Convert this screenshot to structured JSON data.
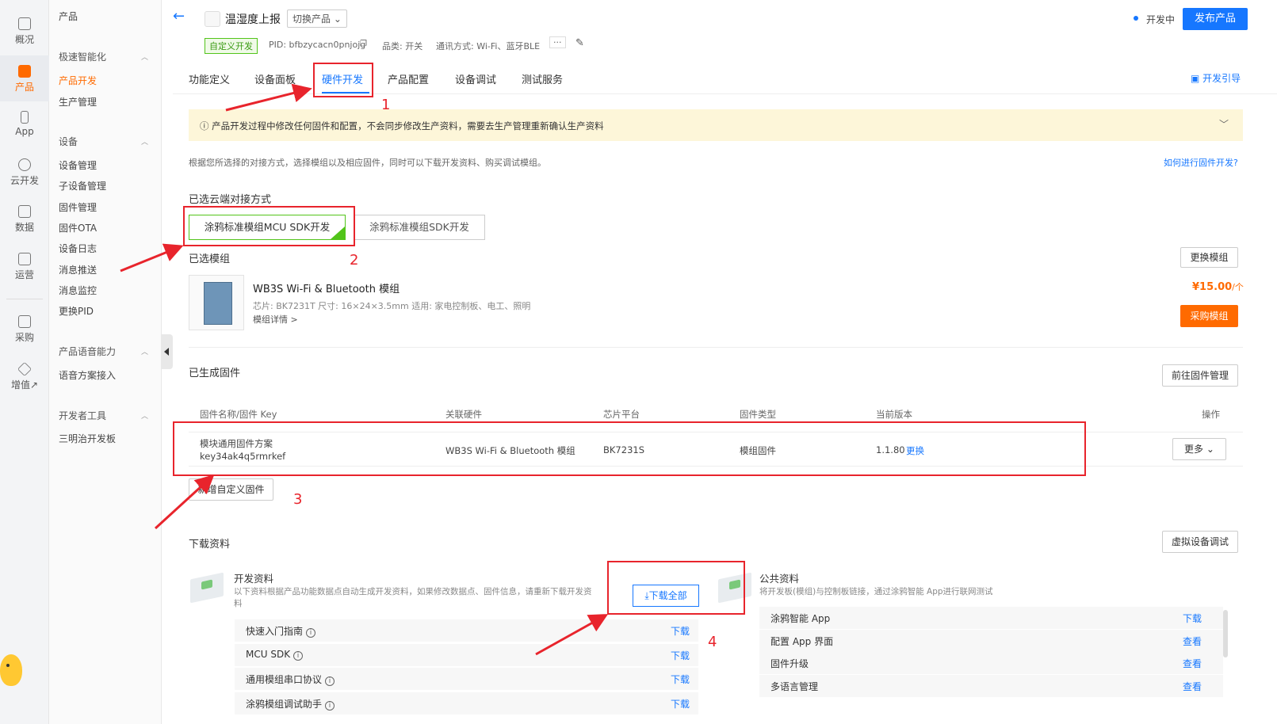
{
  "rail": [
    {
      "label": "概况",
      "icon": "home-icon"
    },
    {
      "label": "产品",
      "icon": "terminal-icon",
      "active": true
    },
    {
      "label": "App",
      "icon": "phone-icon"
    },
    {
      "label": "云开发",
      "icon": "cloud-icon"
    },
    {
      "label": "数据",
      "icon": "chart-icon"
    },
    {
      "label": "运营",
      "icon": "operate-icon"
    },
    {
      "label": "采购",
      "icon": "shop-icon"
    },
    {
      "label": "增值↗",
      "icon": "diamond-icon"
    }
  ],
  "menu": {
    "title": "产品",
    "groups": [
      {
        "label": "极速智能化",
        "items": [
          "产品开发",
          "生产管理"
        ]
      },
      {
        "label": "设备",
        "items": [
          "设备管理",
          "子设备管理",
          "固件管理",
          "固件OTA",
          "设备日志",
          "消息推送",
          "消息监控",
          "更换PID"
        ]
      },
      {
        "label": "产品语音能力",
        "items": [
          "语音方案接入"
        ]
      },
      {
        "label": "开发者工具",
        "items": [
          "三明治开发板"
        ]
      }
    ]
  },
  "header": {
    "product_name": "温湿度上报",
    "switch_label": "切换产品",
    "tag": "自定义开发",
    "pid": "PID: bfbzycacn0pnjojg",
    "category": "品类: 开关",
    "protocol": "通讯方式: Wi-Fi、蓝牙BLE",
    "more": "···",
    "dev_status": "开发中",
    "publish": "发布产品"
  },
  "tabs": [
    "功能定义",
    "设备面板",
    "硬件开发",
    "产品配置",
    "设备调试",
    "测试服务"
  ],
  "guide_link": "开发引导",
  "notice": "产品开发过程中修改任何固件和配置，不会同步修改生产资料，需要去生产管理重新确认生产资料",
  "description": "根据您所选择的对接方式，选择模组以及相应固件，同时可以下载开发资料、购买调试模组。",
  "how_link": "如何进行固件开发?",
  "access": {
    "title": "已选云端对接方式",
    "options": [
      "涂鸦标准模组MCU SDK开发",
      "涂鸦标准模组SDK开发"
    ]
  },
  "module": {
    "title": "已选模组",
    "change_btn": "更换模组",
    "name": "WB3S Wi-Fi & Bluetooth 模组",
    "spec": "芯片: BK7231T   尺寸: 16×24×3.5mm   适用: 家电控制板、电工、照明",
    "detail": "模组详情 >",
    "price": "¥15.00",
    "price_unit": "/个",
    "buy": "采购模组"
  },
  "firmware": {
    "title": "已生成固件",
    "manage_btn": "前往固件管理",
    "headers": [
      "固件名称/固件 Key",
      "关联硬件",
      "芯片平台",
      "固件类型",
      "当前版本",
      "操作"
    ],
    "row": {
      "name": "模块通用固件方案",
      "key": "key34ak4q5rmrkef",
      "hardware": "WB3S Wi-Fi & Bluetooth 模组",
      "chip": "BK7231S",
      "type": "模组固件",
      "version": "1.1.80",
      "change": "更换",
      "more": "更多"
    },
    "add_btn": "新增自定义固件"
  },
  "downloads": {
    "title": "下载资料",
    "virtual_btn": "虚拟设备调试",
    "dev": {
      "title": "开发资料",
      "desc1": "以下资料根据产品功能数据点自动生成开发资料，如果修改数据点、固件信息，请重新下载开发资",
      "desc2": "料",
      "download_all": "下载全部",
      "items": [
        {
          "label": "快速入门指南",
          "link": "下载"
        },
        {
          "label": "MCU SDK",
          "link": "下载"
        },
        {
          "label": "通用模组串口协议",
          "link": "下载"
        },
        {
          "label": "涂鸦模组调试助手",
          "link": "下载"
        }
      ]
    },
    "public": {
      "title": "公共资料",
      "desc": "将开发板(模组)与控制板链接，通过涂鸦智能 App进行联网测试",
      "items": [
        {
          "label": "涂鸦智能 App",
          "link": "下载"
        },
        {
          "label": "配置 App 界面",
          "link": "查看"
        },
        {
          "label": "固件升级",
          "link": "查看"
        },
        {
          "label": "多语言管理",
          "link": "查看"
        }
      ]
    }
  },
  "annotations": [
    "1",
    "2",
    "3",
    "4"
  ],
  "colors": {
    "primary": "#1677ff",
    "accent": "#ff6a00",
    "annotation": "#e8242c",
    "success": "#52c41a"
  }
}
